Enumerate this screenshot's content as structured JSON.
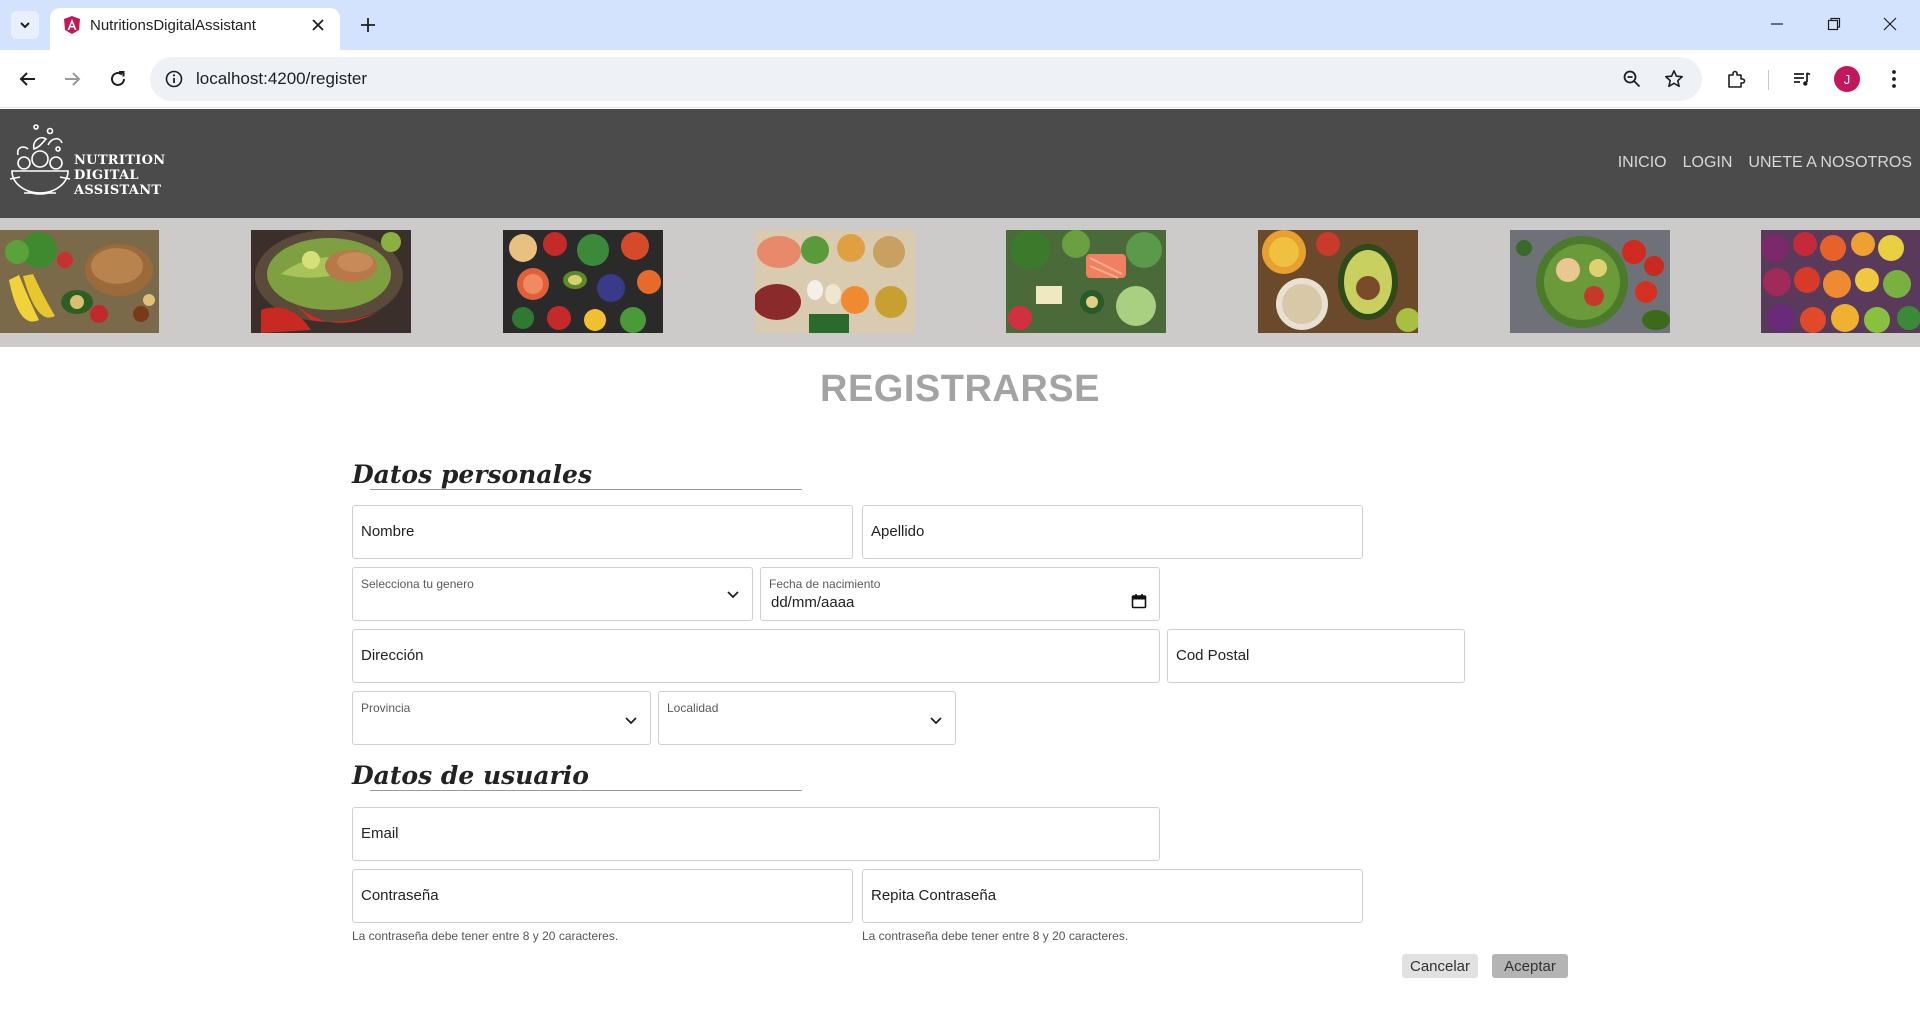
{
  "browser": {
    "tab_title": "NutritionsDigitalAssistant",
    "url": "localhost:4200/register",
    "profile_initial": "J"
  },
  "header": {
    "logo_lines": [
      "NUTRITION",
      "DIGITAL",
      "ASSISTANT"
    ],
    "nav": [
      "INICIO",
      "LOGIN",
      "UNETE A NOSOTROS"
    ]
  },
  "gallery": {
    "images": [
      "vegetables-bread-icon",
      "salad-bowl-icon",
      "fruits-berries-icon",
      "protein-mix-icon",
      "salmon-greens-icon",
      "avocado-bowls-icon",
      "chickpea-salad-icon",
      "rainbow-produce-icon"
    ]
  },
  "form": {
    "title": "REGISTRARSE",
    "personal_heading": "Datos personales",
    "user_heading": "Datos de usuario",
    "nombre": "Nombre",
    "apellido": "Apellido",
    "genero_label": "Selecciona tu genero",
    "fecha_label": "Fecha de nacimiento",
    "fecha_value": "dd/mm/aaaa",
    "direccion": "Dirección",
    "cod_postal": "Cod Postal",
    "provincia_label": "Provincia",
    "localidad_label": "Localidad",
    "email": "Email",
    "password": "Contraseña",
    "password_repeat": "Repita Contraseña",
    "password_hint": "La contraseña debe tener entre 8 y 20 caracteres.",
    "cancel": "Cancelar",
    "accept": "Aceptar"
  }
}
